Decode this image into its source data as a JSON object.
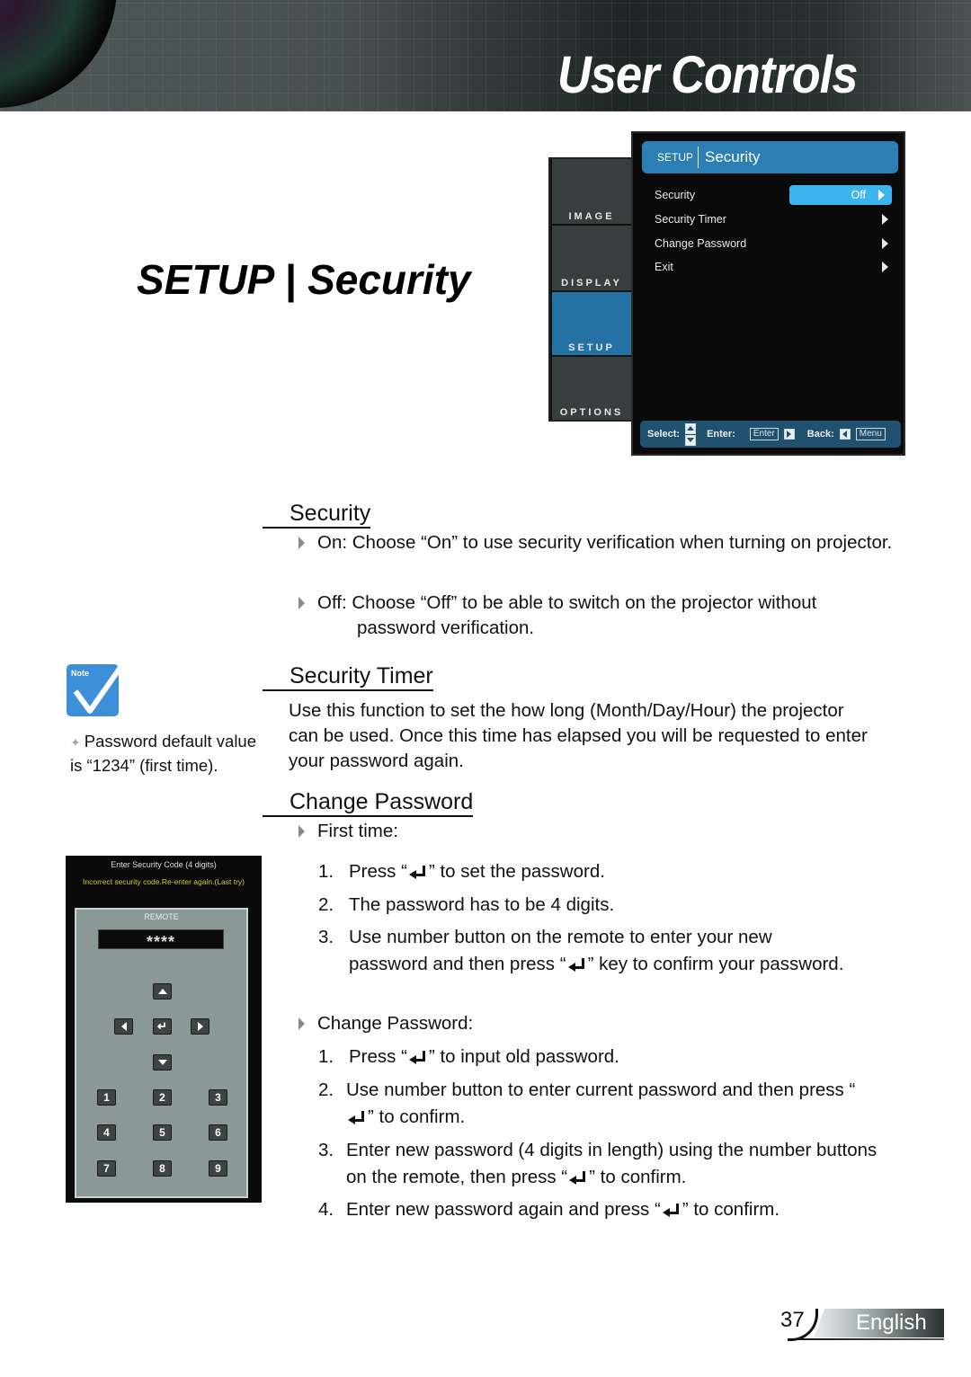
{
  "header": {
    "banner_title": "User Controls"
  },
  "page_heading": "SETUP | Security",
  "osd": {
    "side_tabs": [
      {
        "label": "IMAGE",
        "active": false
      },
      {
        "label": "DISPLAY",
        "active": false
      },
      {
        "label": "SETUP",
        "active": true
      },
      {
        "label": "OPTIONS",
        "active": false
      }
    ],
    "title_small": "SETUP",
    "title_big": "Security",
    "rows": [
      {
        "label": "Security",
        "value": "Off"
      },
      {
        "label": "Security Timer"
      },
      {
        "label": "Change Password"
      },
      {
        "label": "Exit"
      }
    ],
    "help": {
      "select_label": "Select:",
      "enter_label": "Enter:",
      "enter_key": "Enter",
      "back_label": "Back:",
      "menu_key": "Menu"
    },
    "colors": {
      "titlebar": "#2b7fb5",
      "selected_value": "#3cb4ec",
      "active_tab": "#2471a3",
      "help_bar": "#20516e"
    }
  },
  "sections": {
    "security": {
      "title": "Security",
      "bullets": [
        "On: Choose “On” to use security verification when turning on projector.",
        "Off: Choose “Off” to be able to switch on the projector without password verification."
      ]
    },
    "security_timer": {
      "title": "Security Timer",
      "text": "Use this function to set the how long (Month/Day/Hour) the projector can be used. Once this time has elapsed you will be requested to enter your password again."
    },
    "change_password": {
      "title": "Change Password",
      "first_time_label": "First time:",
      "first_time_steps": [
        {
          "n": "1.",
          "pre": "Press “",
          "post": "” to set the password."
        },
        {
          "n": "2.",
          "pre": "The password has to be 4 digits.",
          "post": ""
        },
        {
          "n": "3.",
          "pre": "Use number button on the remote to enter your new password and then press “",
          "post": "” key to confirm your password."
        }
      ],
      "change_label": "Change Password:",
      "change_steps": [
        {
          "n": "1.",
          "pre": "Press “",
          "post": "” to input old password."
        },
        {
          "n": "2.",
          "pre": "Use number button to enter current password and then press “",
          "post": "” to confirm."
        },
        {
          "n": "3.",
          "pre": "Enter new password (4 digits in length) using the number buttons on the remote, then press “",
          "post": "” to confirm."
        },
        {
          "n": "4.",
          "pre": "Enter new password again and press “",
          "post": "” to confirm."
        }
      ]
    }
  },
  "note": {
    "icon_label": "Note",
    "text": "Password default value is “1234” (first time)."
  },
  "code_dialog": {
    "title": "Enter Security Code (4 digits)",
    "warning": "Incorrect security code.Re-enter again.(Last try)",
    "remote_label": "REMOTE",
    "code_value": "****",
    "number_keys": [
      "1",
      "2",
      "3",
      "4",
      "5",
      "6",
      "7",
      "8",
      "9"
    ]
  },
  "footer": {
    "page_number": "37",
    "language": "English"
  }
}
